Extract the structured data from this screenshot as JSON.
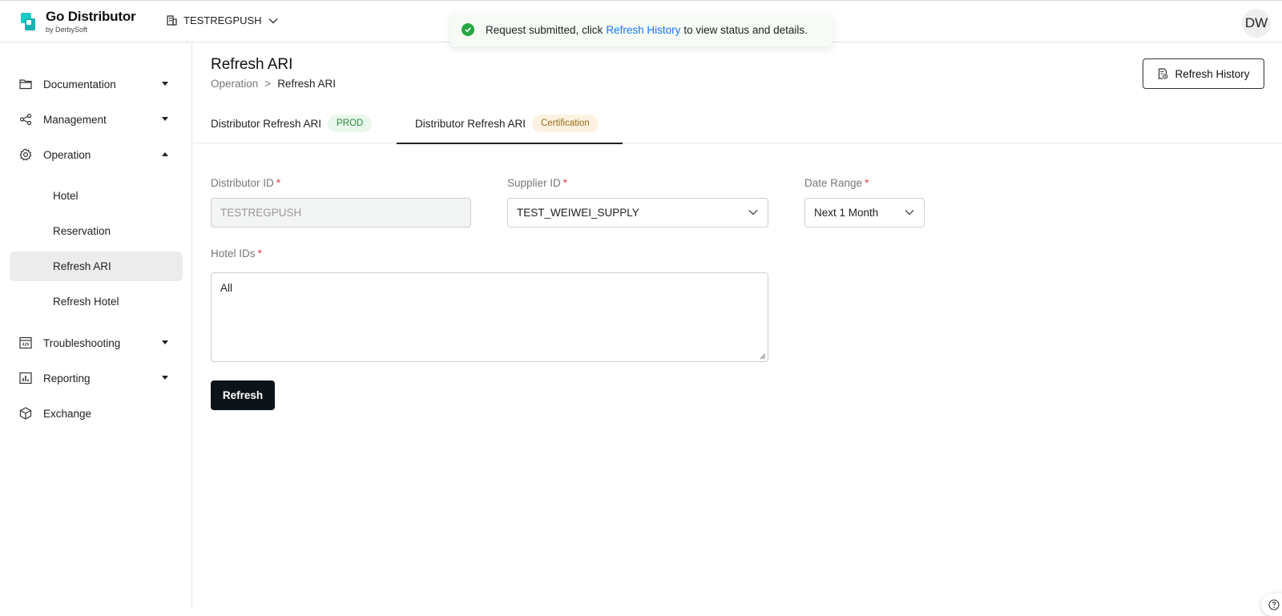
{
  "app": {
    "brand": "Go Distributor",
    "brand_sub": "by DerbySoft",
    "tenant": "TESTREGPUSH",
    "avatar": "DW"
  },
  "toast": {
    "prefix": "Request submitted, click",
    "link": "Refresh History",
    "suffix": "to view status and details."
  },
  "sidebar": {
    "items": [
      {
        "label": "Documentation",
        "icon": "folder-icon"
      },
      {
        "label": "Management",
        "icon": "share-icon"
      },
      {
        "label": "Operation",
        "icon": "gear-icon"
      },
      {
        "label": "Troubleshooting",
        "icon": "code-window-icon"
      },
      {
        "label": "Reporting",
        "icon": "chart-icon"
      },
      {
        "label": "Exchange",
        "icon": "cube-icon"
      }
    ],
    "operation_sub": [
      {
        "label": "Hotel"
      },
      {
        "label": "Reservation"
      },
      {
        "label": "Refresh ARI",
        "active": true
      },
      {
        "label": "Refresh Hotel"
      }
    ]
  },
  "page": {
    "title": "Refresh ARI",
    "breadcrumb": [
      "Operation",
      ">",
      "Refresh ARI"
    ],
    "history_button": "Refresh History"
  },
  "tabs": [
    {
      "label": "Distributor Refresh ARI",
      "badge": "PROD"
    },
    {
      "label": "Distributor Refresh ARI",
      "badge": "Certification",
      "active": true
    }
  ],
  "form": {
    "distributor_id": {
      "label": "Distributor ID",
      "value": "TESTREGPUSH"
    },
    "supplier_id": {
      "label": "Supplier ID",
      "value": "TEST_WEIWEI_SUPPLY"
    },
    "date_range": {
      "label": "Date Range",
      "value": "Next 1 Month"
    },
    "hotel_ids": {
      "label": "Hotel IDs",
      "value": "All"
    },
    "required_mark": "*",
    "submit": "Refresh"
  },
  "colors": {
    "accent": "#1677ff",
    "success": "#28a745",
    "primary_button": "#0d1419",
    "required": "#e23b3b",
    "logo": "#1ec8c8"
  }
}
